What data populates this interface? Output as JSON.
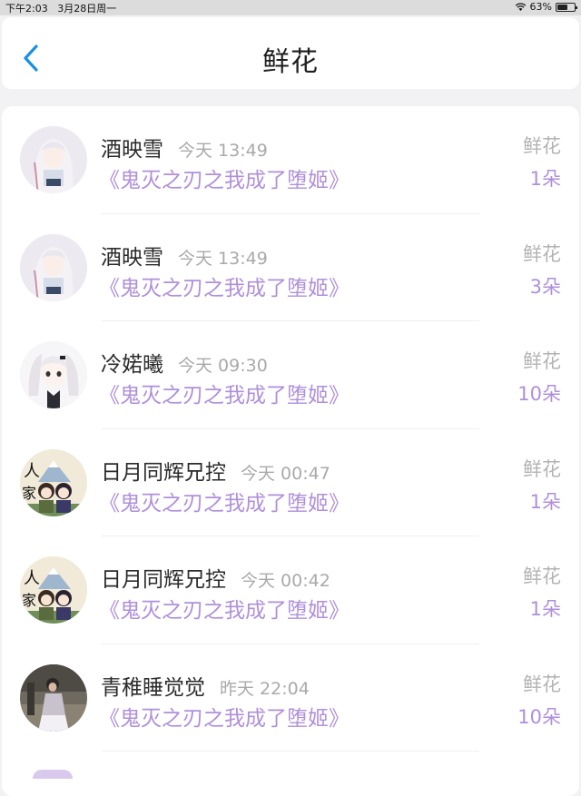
{
  "status_bar": {
    "time": "下午2:03",
    "date": "3月28日周一",
    "battery": "63%",
    "battery_level": 0.63
  },
  "nav": {
    "title": "鲜花",
    "back_icon": "chevron-left-icon",
    "accent": "#1a8fe3"
  },
  "colors": {
    "book": "#b08fdb",
    "muted": "#a9a9a9",
    "name": "#2b2b2b"
  },
  "items": [
    {
      "name": "酒映雪",
      "time": "今天 13:49",
      "book": "《鬼灭之刃之我成了堕姬》",
      "gift": "鲜花",
      "count": "1朵",
      "avatar": "anime-girl-white-hair-avatar"
    },
    {
      "name": "酒映雪",
      "time": "今天 13:49",
      "book": "《鬼灭之刃之我成了堕姬》",
      "gift": "鲜花",
      "count": "3朵",
      "avatar": "anime-girl-white-hair-avatar"
    },
    {
      "name": "冷婼曦",
      "time": "今天 09:30",
      "book": "《鬼灭之刃之我成了堕姬》",
      "gift": "鲜花",
      "count": "10朵",
      "avatar": "anime-girl-twintails-avatar"
    },
    {
      "name": "日月同辉兄控",
      "time": "今天 00:47",
      "book": "《鬼灭之刃之我成了堕姬》",
      "gift": "鲜花",
      "count": "1朵",
      "avatar": "anime-pair-avatar"
    },
    {
      "name": "日月同辉兄控",
      "time": "今天 00:42",
      "book": "《鬼灭之刃之我成了堕姬》",
      "gift": "鲜花",
      "count": "1朵",
      "avatar": "anime-pair-avatar"
    },
    {
      "name": "青稚睡觉觉",
      "time": "昨天 22:04",
      "book": "《鬼灭之刃之我成了堕姬》",
      "gift": "鲜花",
      "count": "10朵",
      "avatar": "photo-person-avatar"
    }
  ]
}
